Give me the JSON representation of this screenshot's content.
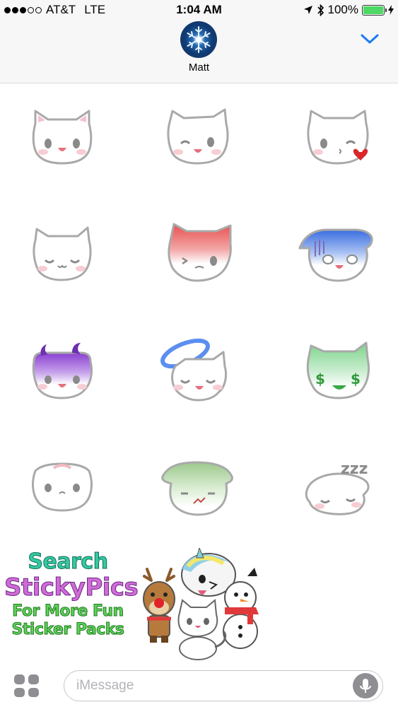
{
  "status_bar": {
    "carrier": "AT&T",
    "network": "LTE",
    "time": "1:04 AM",
    "battery_percent": "100%",
    "signal_bars_filled": 3,
    "signal_bars_total": 5,
    "battery_color": "#4cd964"
  },
  "conversation": {
    "contact_name": "Matt",
    "collapse_icon": "chevron-down-icon",
    "accent_color": "#1a7bf2"
  },
  "stickers": [
    {
      "label": "cat-happy-pink-ears"
    },
    {
      "label": "cat-wink"
    },
    {
      "label": "cat-kiss-heart"
    },
    {
      "label": "cat-content"
    },
    {
      "label": "cat-red-head-sad"
    },
    {
      "label": "cat-blue-head-shocked"
    },
    {
      "label": "cat-devil-horns"
    },
    {
      "label": "cat-angel-halo"
    },
    {
      "label": "cat-money-eyes"
    },
    {
      "label": "cat-ears-down"
    },
    {
      "label": "cat-green-sick"
    },
    {
      "label": "cat-sleeping-zzz"
    }
  ],
  "promo": {
    "line1": "Search",
    "line2": "StickyPics",
    "line3": "For More Fun",
    "line4": "Sticker Packs",
    "sleep_text": "zzz"
  },
  "composer": {
    "placeholder": "iMessage",
    "apps_icon": "apps-grid-icon",
    "mic_icon": "microphone-icon"
  }
}
